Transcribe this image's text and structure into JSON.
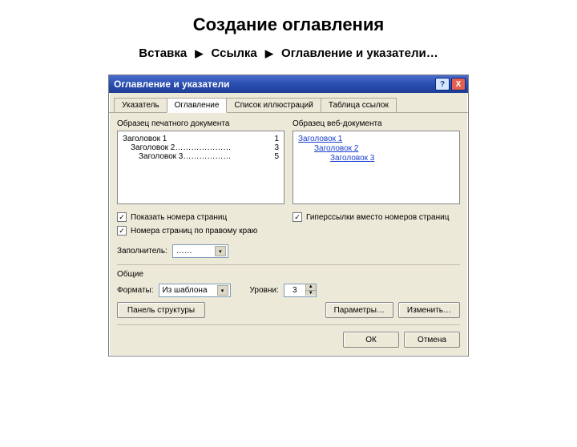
{
  "page": {
    "title": "Создание оглавления"
  },
  "breadcrumb": {
    "items": [
      "Вставка",
      "Ссылка",
      "Оглавление и указатели…"
    ]
  },
  "dialog": {
    "title": "Оглавление и указатели",
    "help_glyph": "?",
    "close_glyph": "X",
    "tabs": [
      "Указатель",
      "Оглавление",
      "Список иллюстраций",
      "Таблица ссылок"
    ],
    "preview": {
      "print_label": "Образец печатного документа",
      "web_label": "Образец веб-документа",
      "print_lines": [
        {
          "text": "Заголовок 1",
          "page": "1",
          "indent": 0
        },
        {
          "text": "Заголовок 2…………………",
          "page": "3",
          "indent": 1
        },
        {
          "text": "Заголовок 3………………",
          "page": "5",
          "indent": 2
        }
      ],
      "web_lines": [
        {
          "text": "Заголовок 1",
          "indent": 0
        },
        {
          "text": "Заголовок 2",
          "indent": 1
        },
        {
          "text": "Заголовок 3",
          "indent": 2
        }
      ]
    },
    "options": {
      "show_pages_label": "Показать номера страниц",
      "right_align_label": "Номера страниц по правому краю",
      "hyperlinks_label": "Гиперссылки вместо номеров страниц",
      "show_pages_checked": "✓",
      "right_align_checked": "✓",
      "hyperlinks_checked": "✓"
    },
    "filler": {
      "label": "Заполнитель:",
      "value": "……"
    },
    "general": {
      "group_label": "Общие",
      "formats_label": "Форматы:",
      "formats_value": "Из шаблона",
      "levels_label": "Уровни:",
      "levels_value": "3"
    },
    "buttons": {
      "toc_panel": "Панель структуры",
      "params": "Параметры…",
      "modify": "Изменить…",
      "ok": "ОК",
      "cancel": "Отмена"
    }
  }
}
